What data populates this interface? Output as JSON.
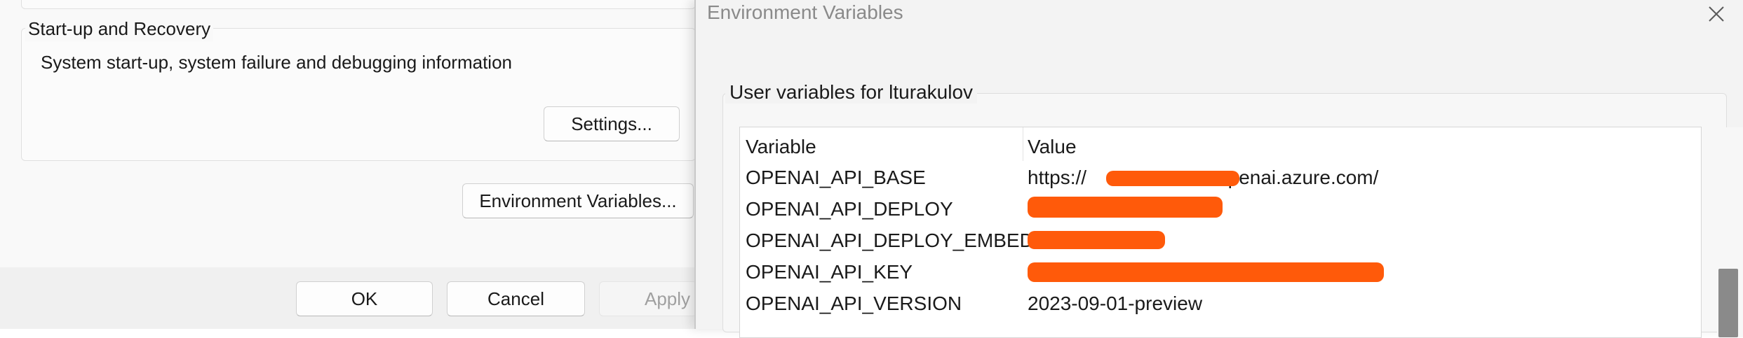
{
  "system_properties": {
    "startup_group": {
      "legend": "Start-up and Recovery",
      "description": "System start-up, system failure and debugging information",
      "settings_label": "Settings..."
    },
    "env_vars_label": "Environment Variables...",
    "ok_label": "OK",
    "cancel_label": "Cancel",
    "apply_label": "Apply"
  },
  "env_dialog": {
    "title": "Environment Variables",
    "close_icon": "close-icon",
    "user_section": {
      "legend": "User variables for lturakulov",
      "columns": {
        "variable": "Variable",
        "value": "Value"
      },
      "rows": [
        {
          "variable": "OPENAI_API_BASE",
          "value_prefix": "https://",
          "value_suffix": "openai.azure.com/",
          "redacted": true
        },
        {
          "variable": "OPENAI_API_DEPLOY",
          "value_prefix": "",
          "value_suffix": "",
          "redacted": true
        },
        {
          "variable": "OPENAI_API_DEPLOY_EMBED",
          "value_prefix": "",
          "value_suffix": "",
          "redacted": true
        },
        {
          "variable": "OPENAI_API_KEY",
          "value_prefix": "",
          "value_suffix": "",
          "redacted": true
        },
        {
          "variable": "OPENAI_API_VERSION",
          "value_prefix": "2023-09-01-preview",
          "value_suffix": "",
          "redacted": false
        }
      ]
    }
  },
  "colors": {
    "redaction": "#ff5a0a",
    "scroll_thumb": "#8a8a8a"
  }
}
